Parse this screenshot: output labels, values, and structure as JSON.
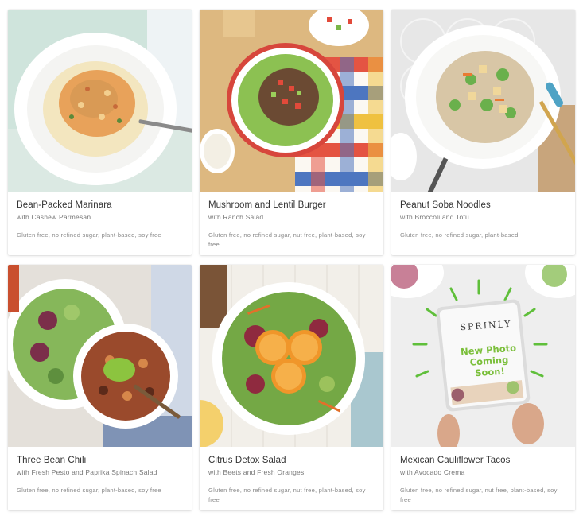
{
  "recipes": [
    {
      "title": "Bean-Packed Marinara",
      "subtitle": "with Cashew Parmesan",
      "tags": "Gluten free, no refined sugar, plant-based, soy free"
    },
    {
      "title": "Mushroom and Lentil Burger",
      "subtitle": "with Ranch Salad",
      "tags": "Gluten free, no refined sugar, nut free, plant-based, soy free"
    },
    {
      "title": "Peanut Soba Noodles",
      "subtitle": "with Broccoli and Tofu",
      "tags": "Gluten free, no refined sugar, plant-based"
    },
    {
      "title": "Three Bean Chili",
      "subtitle": "with Fresh Pesto and Paprika Spinach Salad",
      "tags": "Gluten free, no refined sugar, plant-based, soy free"
    },
    {
      "title": "Citrus Detox Salad",
      "subtitle": "with Beets and Fresh Oranges",
      "tags": "Gluten free, no refined sugar, nut free, plant-based, soy free"
    },
    {
      "title": "Mexican Cauliflower Tacos",
      "subtitle": "with Avocado Crema",
      "tags": "Gluten free, no refined sugar, nut free, plant-based, soy free",
      "placeholder": {
        "brand": "SPRINLY",
        "message": "New Photo Coming Soon!"
      }
    }
  ]
}
